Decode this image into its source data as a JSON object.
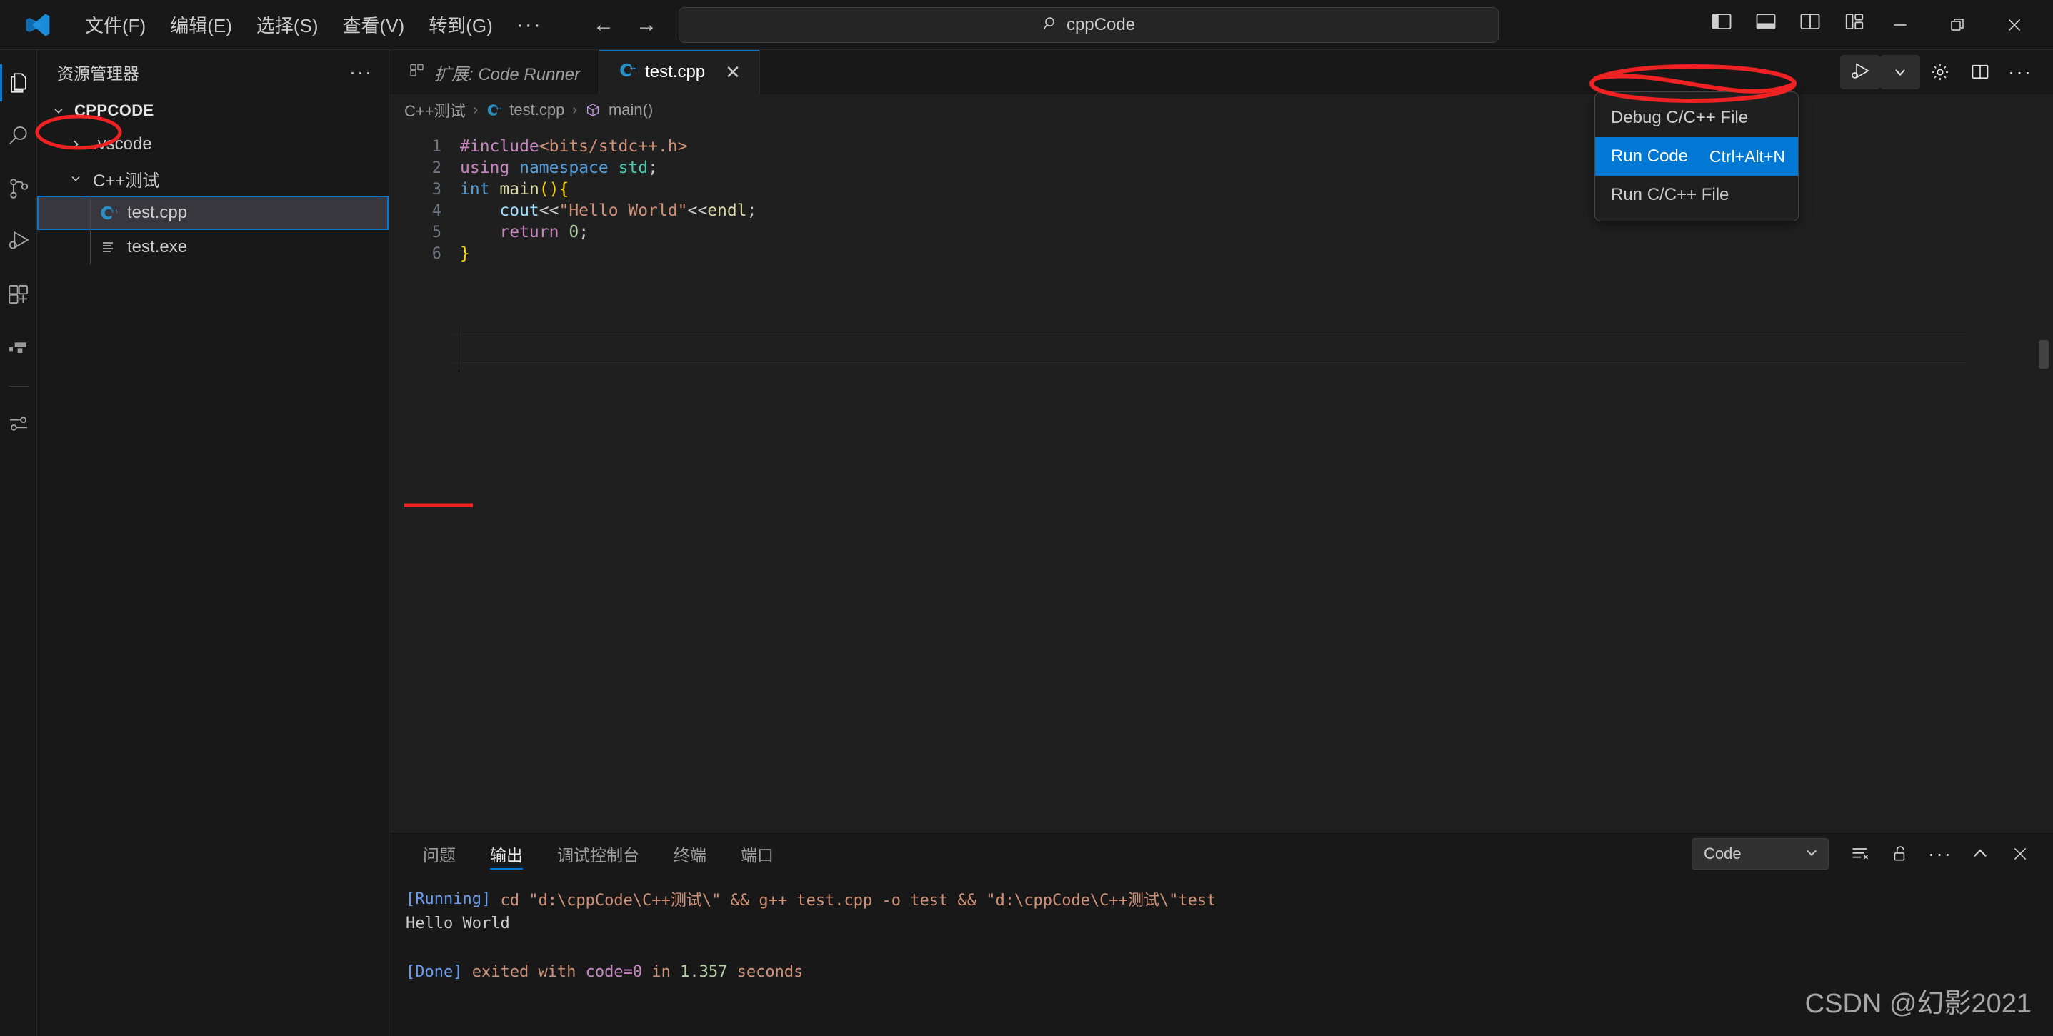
{
  "titlebar": {
    "logo_icon": "vscode-logo-icon",
    "menus": [
      "文件(F)",
      "编辑(E)",
      "选择(S)",
      "查看(V)",
      "转到(G)"
    ],
    "menu_overflow": "···",
    "nav_back_icon": "arrow-left-icon",
    "nav_forward_icon": "arrow-right-icon",
    "search": {
      "value": "cppCode",
      "icon": "search-icon"
    },
    "layout_icons": [
      "toggle-primary-sidebar-icon",
      "toggle-panel-icon",
      "toggle-secondary-sidebar-icon",
      "customize-layout-icon"
    ],
    "window_controls": [
      "minimize-icon",
      "restore-icon",
      "close-icon"
    ]
  },
  "activitybar": {
    "items": [
      {
        "name": "explorer",
        "icon": "files-icon",
        "active": true
      },
      {
        "name": "search",
        "icon": "search-icon",
        "active": false
      },
      {
        "name": "source-control",
        "icon": "source-control-icon",
        "active": false
      },
      {
        "name": "run-and-debug",
        "icon": "debug-icon",
        "active": false
      },
      {
        "name": "extensions",
        "icon": "extensions-icon",
        "active": false
      },
      {
        "name": "testing",
        "icon": "beaker-icon",
        "active": false
      },
      {
        "name": "settings",
        "icon": "sliders-icon",
        "active": false
      }
    ]
  },
  "sidebar": {
    "header": {
      "title": "资源管理器",
      "more_icon": "more-actions-icon"
    },
    "root": {
      "label": "CPPCODE",
      "expanded": true
    },
    "tree": [
      {
        "label": ".vscode",
        "type": "folder",
        "expanded": false,
        "icon": "chevron-right-icon",
        "selected": false,
        "circled": false
      },
      {
        "label": "C++测试",
        "type": "folder",
        "expanded": true,
        "icon": "chevron-down-icon",
        "selected": false,
        "circled": false
      },
      {
        "label": "test.cpp",
        "type": "file",
        "icon": "cpp-file-icon",
        "selected": true,
        "circled": false
      },
      {
        "label": "test.exe",
        "type": "file",
        "icon": "binary-file-icon",
        "selected": false,
        "circled": true
      }
    ]
  },
  "editor": {
    "tabs": [
      {
        "label": "扩展: Code Runner",
        "icon": "extensions-icon",
        "active": false,
        "closable": false
      },
      {
        "label": "test.cpp",
        "icon": "cpp-file-icon",
        "active": true,
        "closable": true,
        "close_icon": "close-icon"
      }
    ],
    "actions": [
      {
        "name": "run-or-debug",
        "icon": "run-play-debug-icon",
        "highlighted": true
      },
      {
        "name": "run-dropdown",
        "icon": "chevron-down-icon",
        "highlighted": true
      },
      {
        "name": "settings",
        "icon": "gear-icon",
        "highlighted": false
      },
      {
        "name": "split-editor",
        "icon": "split-editor-icon",
        "highlighted": false
      },
      {
        "name": "more-actions",
        "icon": "more-actions-icon",
        "highlighted": false
      }
    ],
    "breadcrumb": [
      {
        "label": "C++测试",
        "icon": ""
      },
      {
        "label": "test.cpp",
        "icon": "cpp-file-icon"
      },
      {
        "label": "main()",
        "icon": "symbol-method-icon"
      }
    ],
    "breadcrumb_sep": "›",
    "code": {
      "lines": [
        {
          "n": "1",
          "tokens": [
            {
              "t": "#include",
              "c": "tk-pre"
            },
            {
              "t": "<bits/stdc++.h>",
              "c": "tk-str"
            }
          ]
        },
        {
          "n": "2",
          "tokens": [
            {
              "t": "using",
              "c": "tk-kw"
            },
            {
              "t": " ",
              "c": "tk-pun"
            },
            {
              "t": "namespace",
              "c": "tk-type"
            },
            {
              "t": " ",
              "c": "tk-pun"
            },
            {
              "t": "std",
              "c": "tk-ns"
            },
            {
              "t": ";",
              "c": "tk-pun"
            }
          ]
        },
        {
          "n": "3",
          "tokens": [
            {
              "t": "int",
              "c": "tk-type"
            },
            {
              "t": " ",
              "c": "tk-pun"
            },
            {
              "t": "main",
              "c": "tk-fn"
            },
            {
              "t": "()",
              "c": "tk-br"
            },
            {
              "t": "{",
              "c": "tk-br"
            }
          ]
        },
        {
          "n": "4",
          "tokens": [
            {
              "t": "    ",
              "c": "tk-pun"
            },
            {
              "t": "cout",
              "c": "tk-var"
            },
            {
              "t": "<<",
              "c": "tk-pun"
            },
            {
              "t": "\"Hello World\"",
              "c": "tk-str"
            },
            {
              "t": "<<",
              "c": "tk-pun"
            },
            {
              "t": "endl",
              "c": "tk-fn"
            },
            {
              "t": ";",
              "c": "tk-pun"
            }
          ]
        },
        {
          "n": "5",
          "tokens": [
            {
              "t": "    ",
              "c": "tk-pun"
            },
            {
              "t": "return",
              "c": "tk-kw"
            },
            {
              "t": " ",
              "c": "tk-pun"
            },
            {
              "t": "0",
              "c": "tk-num"
            },
            {
              "t": ";",
              "c": "tk-pun"
            }
          ]
        },
        {
          "n": "6",
          "tokens": [
            {
              "t": "}",
              "c": "tk-br"
            }
          ]
        }
      ]
    }
  },
  "context_menu": {
    "items": [
      {
        "label": "Debug C/C++ File",
        "shortcut": "",
        "selected": false
      },
      {
        "label": "Run Code",
        "shortcut": "Ctrl+Alt+N",
        "selected": true
      },
      {
        "label": "Run C/C++ File",
        "shortcut": "",
        "selected": false
      }
    ]
  },
  "panel": {
    "tabs": [
      {
        "label": "问题",
        "active": false
      },
      {
        "label": "输出",
        "active": true
      },
      {
        "label": "调试控制台",
        "active": false
      },
      {
        "label": "终端",
        "active": false
      },
      {
        "label": "端口",
        "active": false
      }
    ],
    "channel_select": {
      "value": "Code",
      "chevron_icon": "chevron-down-icon"
    },
    "actions": [
      {
        "name": "clear-output",
        "icon": "clear-output-icon"
      },
      {
        "name": "toggle-lock-scroll",
        "icon": "unlock-icon"
      },
      {
        "name": "more-actions",
        "icon": "more-actions-icon"
      },
      {
        "name": "maximize-panel",
        "icon": "chevron-up-icon"
      },
      {
        "name": "close-panel",
        "icon": "close-icon"
      }
    ],
    "output": [
      {
        "segments": [
          {
            "text": "[Running]",
            "c": "o-blue"
          },
          {
            "text": " cd \"d:\\cppCode\\C++测试\\\" && g++ test.cpp -o test && \"d:\\cppCode\\C++测试\\\"test",
            "c": "o-org"
          }
        ]
      },
      {
        "segments": [
          {
            "text": "Hello World",
            "c": "o-wht"
          }
        ],
        "underlined": true
      },
      {
        "segments": [
          {
            "text": "",
            "c": "o-wht"
          }
        ]
      },
      {
        "segments": [
          {
            "text": "[Done]",
            "c": "o-blue"
          },
          {
            "text": " exited with ",
            "c": "o-org"
          },
          {
            "text": "code=0",
            "c": "o-pur"
          },
          {
            "text": " in ",
            "c": "o-org"
          },
          {
            "text": "1.357",
            "c": "o-grn"
          },
          {
            "text": " seconds",
            "c": "o-org"
          }
        ]
      }
    ]
  },
  "watermark": "CSDN @幻影2021",
  "colors": {
    "accent": "#0078d4",
    "annotation": "#ee2222",
    "editor_bg": "#1f1f1f",
    "chrome_bg": "#181818",
    "selected_row": "#37373d"
  }
}
